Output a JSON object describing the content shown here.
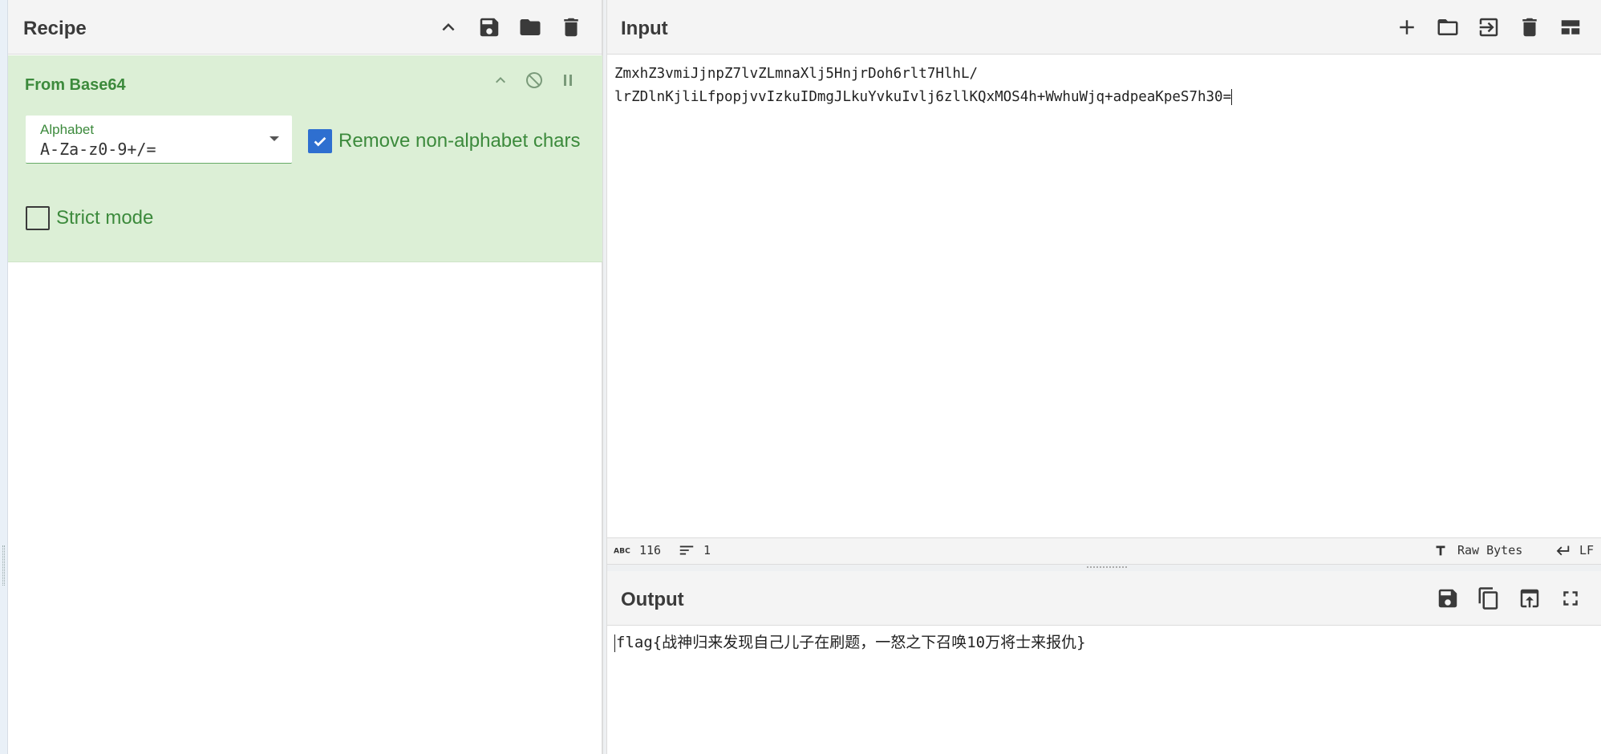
{
  "recipe": {
    "title": "Recipe",
    "header_icons": [
      "chevron-up-icon",
      "save-icon",
      "folder-icon",
      "trash-icon"
    ],
    "operation": {
      "title": "From Base64",
      "icons": [
        "chevron-up-icon",
        "disable-icon",
        "pause-icon"
      ],
      "alphabet_label": "Alphabet",
      "alphabet_value": "A-Za-z0-9+/=",
      "remove_non_alphabet_label": "Remove non-alphabet chars",
      "remove_non_alphabet_checked": true,
      "strict_mode_label": "Strict mode",
      "strict_mode_checked": false
    }
  },
  "input": {
    "title": "Input",
    "header_icons": [
      "plus-icon",
      "folder-icon",
      "import-icon",
      "trash-icon",
      "layout-icon"
    ],
    "text_line1": "ZmxhZ3vmiJjnpZ7lvZLmnaXlj5HnjrDoh6rlt7HlhL/",
    "text_line2": "lrZDlnKjliLfpopjvvIzkuIDmgJLkuYvkuIvlj6zllKQxMOS4h+WwhuWjq+adpeaKpeS7h30=",
    "status": {
      "length_icon": "abc-icon",
      "length": "116",
      "lines_icon": "lines-icon",
      "lines": "1",
      "encoding": "Raw Bytes",
      "eol": "LF"
    }
  },
  "output": {
    "title": "Output",
    "header_icons": [
      "save-icon",
      "copy-icon",
      "replace-input-icon",
      "maximise-icon"
    ],
    "text": "flag{战神归来发现自己儿子在刷题，一怒之下召唤10万将士来报仇}"
  },
  "colors": {
    "operation_bg": "#dcefd6",
    "operation_text": "#3c8a3c",
    "checkbox_checked": "#2e6fd0"
  }
}
